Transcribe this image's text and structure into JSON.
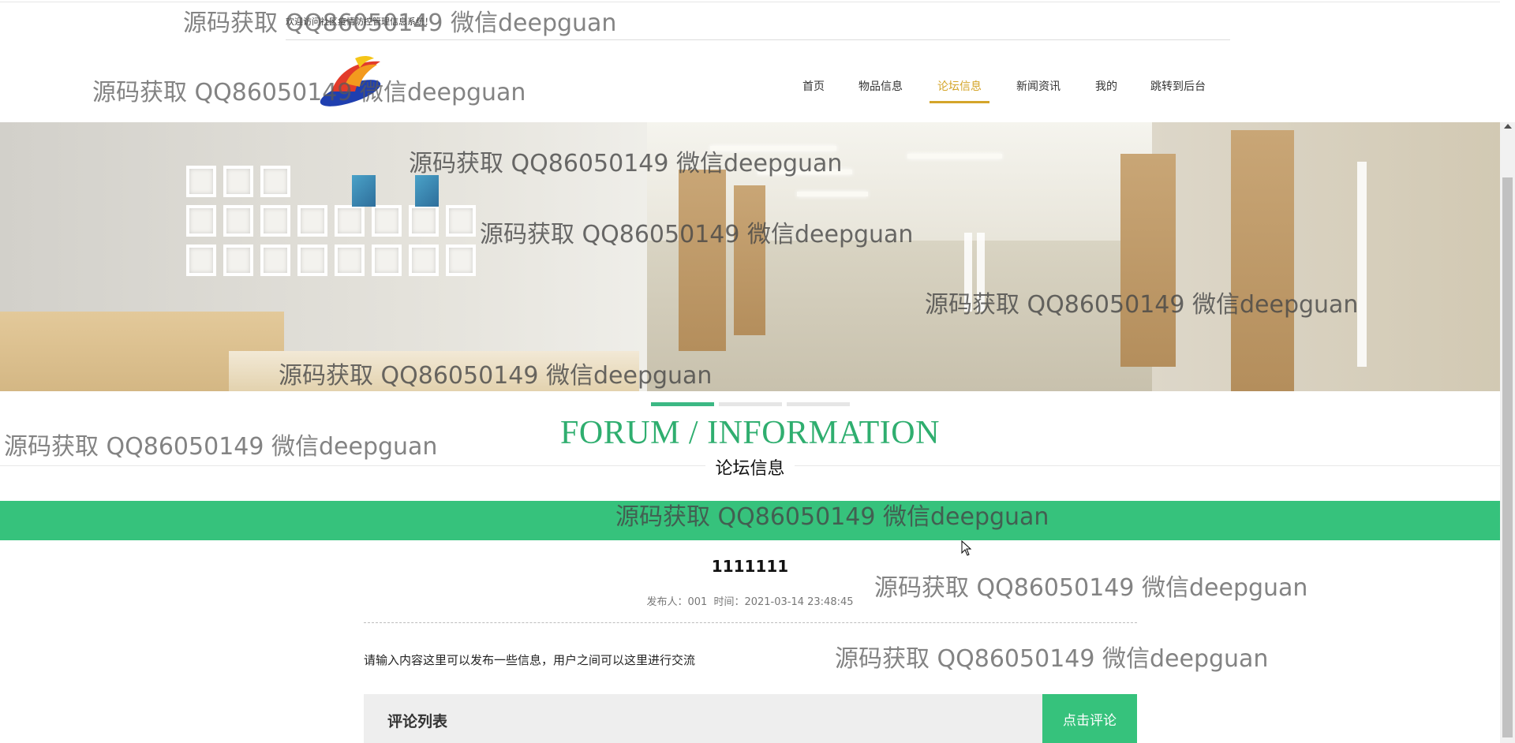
{
  "header": {
    "welcome_text": "欢迎访问社区疫情防控管理信息系统！"
  },
  "nav": {
    "items": [
      {
        "label": "首页",
        "active": false
      },
      {
        "label": "物品信息",
        "active": false
      },
      {
        "label": "论坛信息",
        "active": true
      },
      {
        "label": "新闻资讯",
        "active": false
      },
      {
        "label": "我的",
        "active": false
      },
      {
        "label": "跳转到后台",
        "active": false
      }
    ]
  },
  "banner": {
    "slides": 3,
    "active_slide": 1
  },
  "section": {
    "title": "FORUM / INFORMATION",
    "subtitle": "论坛信息"
  },
  "post": {
    "title": "1111111",
    "author_label": "发布人：001",
    "time_label": "时间：2021-03-14 23:48:45",
    "content": "请输入内容这里可以发布一些信息，用户之间可以这里进行交流"
  },
  "comments": {
    "header": "评论列表",
    "button_label": "点击评论"
  },
  "watermark": "源码获取 QQ86050149 微信deepguan",
  "colors": {
    "accent_green": "#36c27c",
    "title_green": "#2fae6f",
    "nav_active": "#d4a52a"
  }
}
